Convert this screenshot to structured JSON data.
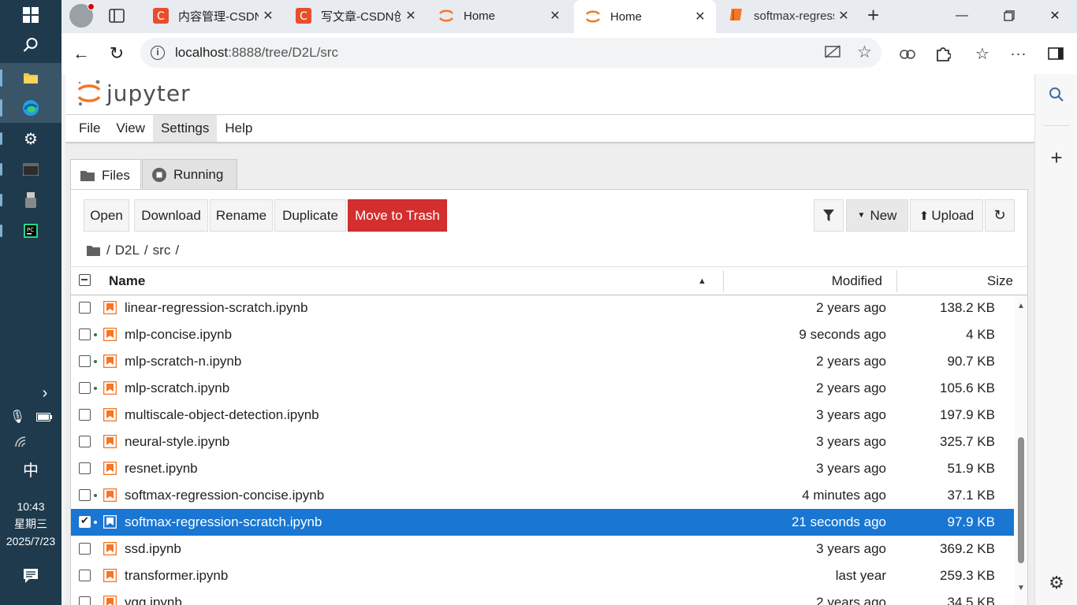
{
  "taskbar": {
    "time": "10:43",
    "weekday": "星期三",
    "date": "2025/7/23",
    "ime": "中"
  },
  "browser": {
    "tabs": [
      {
        "label": "内容管理-CSDN",
        "icon": "csdn-icon"
      },
      {
        "label": "写文章-CSDN创",
        "icon": "csdn-icon"
      },
      {
        "label": "Home",
        "icon": "jupyter-icon"
      },
      {
        "label": "Home",
        "icon": "jupyter-icon"
      },
      {
        "label": "softmax-regress",
        "icon": "notebook-tab-icon"
      }
    ],
    "url_host": "localhost",
    "url_path": ":8888/tree/D2L/src"
  },
  "jupyter": {
    "brand": "jupyter",
    "menu": [
      "File",
      "View",
      "Settings",
      "Help"
    ],
    "tabs": {
      "files": "Files",
      "running": "Running"
    },
    "toolbar": {
      "open": "Open",
      "download": "Download",
      "rename": "Rename",
      "duplicate": "Duplicate",
      "trash": "Move to Trash",
      "new": "New",
      "upload": "Upload"
    },
    "breadcrumb": [
      "/",
      "D2L",
      "/",
      "src",
      "/"
    ],
    "columns": {
      "name": "Name",
      "modified": "Modified",
      "size": "Size"
    },
    "files": [
      {
        "name": "linear-regression-scratch.ipynb",
        "modified": "2 years ago",
        "size": "138.2 KB",
        "running": false,
        "selected": false
      },
      {
        "name": "mlp-concise.ipynb",
        "modified": "9 seconds ago",
        "size": "4 KB",
        "running": true,
        "selected": false
      },
      {
        "name": "mlp-scratch-n.ipynb",
        "modified": "2 years ago",
        "size": "90.7 KB",
        "running": true,
        "selected": false
      },
      {
        "name": "mlp-scratch.ipynb",
        "modified": "2 years ago",
        "size": "105.6 KB",
        "running": true,
        "selected": false
      },
      {
        "name": "multiscale-object-detection.ipynb",
        "modified": "3 years ago",
        "size": "197.9 KB",
        "running": false,
        "selected": false
      },
      {
        "name": "neural-style.ipynb",
        "modified": "3 years ago",
        "size": "325.7 KB",
        "running": false,
        "selected": false
      },
      {
        "name": "resnet.ipynb",
        "modified": "3 years ago",
        "size": "51.9 KB",
        "running": false,
        "selected": false
      },
      {
        "name": "softmax-regression-concise.ipynb",
        "modified": "4 minutes ago",
        "size": "37.1 KB",
        "running": true,
        "selected": false
      },
      {
        "name": "softmax-regression-scratch.ipynb",
        "modified": "21 seconds ago",
        "size": "97.9 KB",
        "running": true,
        "selected": true
      },
      {
        "name": "ssd.ipynb",
        "modified": "3 years ago",
        "size": "369.2 KB",
        "running": false,
        "selected": false
      },
      {
        "name": "transformer.ipynb",
        "modified": "last year",
        "size": "259.3 KB",
        "running": false,
        "selected": false
      },
      {
        "name": "vgg.ipynb",
        "modified": "2 years ago",
        "size": "34.5 KB",
        "running": false,
        "selected": false
      }
    ]
  },
  "colors": {
    "selected_row": "#1976d2",
    "trash_button": "#d32f2f",
    "notebook_icon": "#f37726",
    "running_dot": "#2e7d32"
  }
}
